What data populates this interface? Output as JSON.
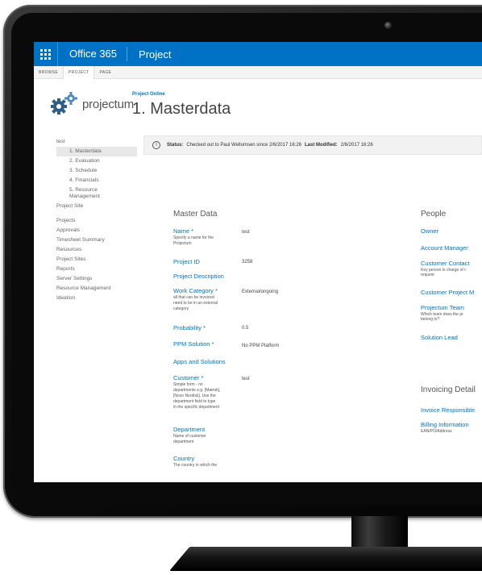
{
  "topbar": {
    "brand": "Office 365",
    "app": "Project"
  },
  "ribbon": {
    "tabs": [
      "BROWSE",
      "PROJECT",
      "PAGE"
    ]
  },
  "logo": {
    "text": "projectum"
  },
  "breadcrumb": "Project Online",
  "page_title": "1. Masterdata",
  "nav": {
    "root": "test",
    "sub_items": [
      "1. Masterdata",
      "2. Evaluation",
      "3. Schedule",
      "4. Financials"
    ],
    "sub_item_multi": [
      "5. Resource",
      "Management"
    ],
    "project_site": "Project Site",
    "main_items": [
      "Projects",
      "Approvals",
      "Timesheet Summary",
      "Resources",
      "Project Sites",
      "Reports",
      "Server Settings",
      "Resource Management",
      "Ideation"
    ]
  },
  "status": {
    "status_label": "Status:",
    "status_text": "Checked out to Paul Wellumsen since 2/6/2017 16:26",
    "modified_label": "Last Modified:",
    "modified_text": "2/6/2017 16:26"
  },
  "master_data": {
    "heading": "Master Data",
    "fields": [
      {
        "label": "Name *",
        "desc": [
          "Specify a name for the",
          "Projectum"
        ],
        "value": "test"
      },
      {
        "label": "Project ID",
        "desc": [],
        "value": "3258"
      },
      {
        "label": "Project Description",
        "desc": [],
        "value": ""
      },
      {
        "label": "Work Category *",
        "desc": [
          "all that can be invoiced",
          "need to be in an external",
          "category"
        ],
        "value": "External/ongoing"
      },
      {
        "label": "Probability *",
        "desc": [],
        "value": "0.5"
      },
      {
        "label": "PPM Solution *",
        "desc": [],
        "value": "No PPM Platform"
      },
      {
        "label": "Apps and Solutions",
        "desc": [],
        "value": ""
      },
      {
        "label": "Customer *",
        "desc": [
          "Simple form - no",
          "departments e.g. [Mærsk],",
          "[Novo Nordisk]. Use the",
          "department field to type",
          "in the specific department"
        ],
        "value": "test"
      },
      {
        "label": "Department",
        "desc": [
          "Name of customer",
          "department"
        ],
        "value": ""
      },
      {
        "label": "Country",
        "desc": [
          "The country in which the"
        ],
        "value": ""
      }
    ]
  },
  "people": {
    "heading": "People",
    "items": [
      {
        "label": "Owner",
        "desc": []
      },
      {
        "label": "Account Manager",
        "desc": []
      },
      {
        "label": "Customer Contact",
        "desc": [
          "Key person in charge of t",
          "request"
        ]
      },
      {
        "label": "Customer Project M",
        "desc": []
      },
      {
        "label": "Projectum Team",
        "desc": [
          "Which team does the pr",
          "belong to?"
        ]
      },
      {
        "label": "Solution Lead",
        "desc": []
      }
    ]
  },
  "invoicing": {
    "heading": "Invoicing Detail",
    "items": [
      {
        "label": "Invoice Responsible",
        "desc": []
      },
      {
        "label": "Billing Information",
        "desc": [
          "EAN/PO/Address"
        ]
      }
    ]
  }
}
